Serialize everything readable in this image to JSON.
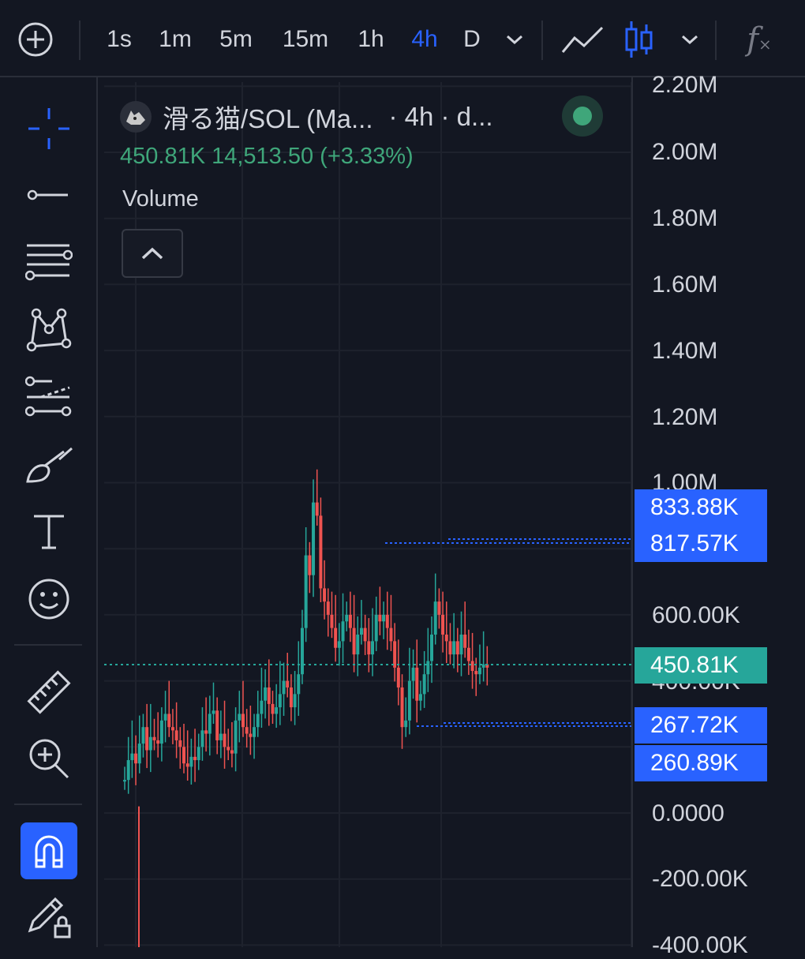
{
  "toolbar": {
    "timeframes": [
      "1s",
      "1m",
      "5m",
      "15m",
      "1h",
      "4h",
      "D"
    ],
    "active_timeframe": "4h",
    "indicator_symbol": "f"
  },
  "legend": {
    "symbol_title": "滑る猫/SOL (Ma...",
    "interval": "· 4h · d...",
    "values": "450.81K  14,513.50 (+3.33%)",
    "indicator": "Volume"
  },
  "price_axis": {
    "labels": [
      "2.20M",
      "2.00M",
      "1.80M",
      "1.60M",
      "1.40M",
      "1.20M",
      "1.00M",
      "600.00K",
      "400.00K",
      "0.0000",
      "-200.00K",
      "-400.00K"
    ],
    "tags": [
      {
        "label": "833.88K",
        "type": "blue"
      },
      {
        "label": "817.57K",
        "type": "blue"
      },
      {
        "label": "450.81K",
        "type": "green"
      },
      {
        "label": "267.72K",
        "type": "blue"
      },
      {
        "label": "260.89K",
        "type": "blue"
      }
    ]
  },
  "colors": {
    "up": "#26a69a",
    "down": "#ef5350",
    "accent": "#2962ff",
    "background": "#131722"
  },
  "left_tools": [
    "crosshair-icon",
    "trend-line-icon",
    "fib-retracement-icon",
    "pattern-icon",
    "projection-icon",
    "brush-icon",
    "text-icon",
    "emoji-icon",
    "ruler-icon",
    "zoom-in-icon",
    "magnet-icon",
    "lock-drawing-icon"
  ]
}
